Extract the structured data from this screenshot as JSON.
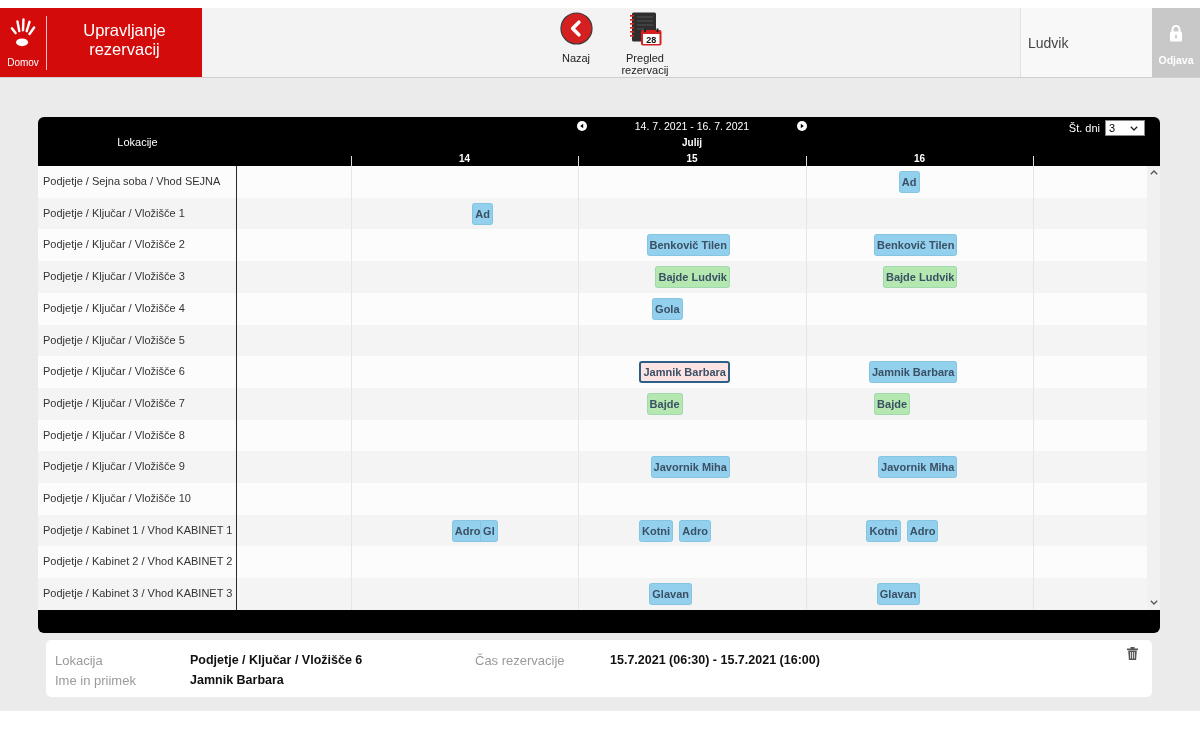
{
  "header": {
    "home": {
      "label": "Domov"
    },
    "title": "Upravljanje rezervacij",
    "toolbar": [
      {
        "kind": "back",
        "label": "Nazaj"
      },
      {
        "kind": "calendar",
        "label": "Pregled rezervacij",
        "icon_text": "28"
      }
    ],
    "user": "Ludvik",
    "logout": {
      "label": "Odjava"
    }
  },
  "scheduler": {
    "locations_heading": "Lokacije",
    "range": "14. 7. 2021 - 16. 7. 2021",
    "month": "Julij",
    "days": [
      "14",
      "15",
      "16"
    ],
    "days_count": {
      "label": "Št. dni",
      "value": "3"
    },
    "rows": [
      {
        "location": "Podjetje / Sejna soba / Vhod SEJNA",
        "events": [
          {
            "text": "Ad",
            "level": 0.75,
            "color": "#93d0ee",
            "selected": false
          }
        ]
      },
      {
        "location": "Podjetje / Ključar / Vložišče 1",
        "events": [
          {
            "text": "Ad",
            "level": 0.2813,
            "color": "#93d0ee",
            "selected": false
          }
        ]
      },
      {
        "location": "Podjetje / Ključar / Vložišče 2",
        "events": [
          {
            "text": "Benkovič Tilen",
            "level": 0.5417,
            "color": "#93d0ee",
            "selected": false
          },
          {
            "text": "Benkovič Tilen",
            "level": 0.7917,
            "color": "#93d0ee",
            "selected": false
          }
        ]
      },
      {
        "location": "Podjetje / Ključar / Vložišče 3",
        "events": [
          {
            "text": "Bajde Ludvik",
            "level": 0.5417,
            "color": "#b5e8b0",
            "selected": false
          },
          {
            "text": "Bajde Ludvik",
            "level": 0.7917,
            "color": "#b5e8b0",
            "selected": false
          }
        ]
      },
      {
        "location": "Podjetje / Ključar / Vložišče 4",
        "events": [
          {
            "text": "Gola",
            "level": 0.4896,
            "color": "#93d0ee",
            "selected": false
          }
        ]
      },
      {
        "location": "Podjetje / Ključar / Vložišče 5"
      },
      {
        "location": "Podjetje / Ključar / Vložišče 6",
        "events": [
          {
            "text": "Jamnik Barbara",
            "level": 0.5417,
            "selected": true
          },
          {
            "text": "Jamnik Barbara",
            "level": 0.7917,
            "color": "#93d0ee",
            "selected": false
          }
        ]
      },
      {
        "location": "Podjetje / Ključar / Vložišče 7",
        "events": [
          {
            "text": "Bajde",
            "level": 0.4896,
            "color": "#b5e8b0",
            "selected": false
          },
          {
            "text": "Bajde",
            "level": 0.7396,
            "color": "#b5e8b0",
            "selected": false
          }
        ]
      },
      {
        "location": "Podjetje / Ključar / Vložišče 8"
      },
      {
        "location": "Podjetje / Ključar / Vložišče 9",
        "events": [
          {
            "text": "Javornik Miha",
            "level": 0.5417,
            "color": "#93d0ee",
            "selected": false
          },
          {
            "text": "Javornik Miha",
            "level": 0.7917,
            "color": "#93d0ee",
            "selected": false
          }
        ]
      },
      {
        "location": "Podjetje / Ključar / Vložišče 10"
      },
      {
        "location": "Podjetje / Kabinet 1 / Vhod KABINET 1",
        "events": [
          {
            "text": "Adro",
            "level": 0.2708,
            "color": "#93d0ee",
            "selected": false
          },
          {
            "text": "Gl",
            "level": 0.2865,
            "color": "#93d0ee",
            "selected": false
          },
          {
            "text": "Kotni",
            "level": 0.4792,
            "color": "#93d0ee",
            "selected": false
          },
          {
            "text": "Adro",
            "level": 0.5208,
            "color": "#93d0ee",
            "selected": false
          },
          {
            "text": "Kotni",
            "level": 0.7292,
            "color": "#93d0ee",
            "selected": false
          },
          {
            "text": "Adro",
            "level": 0.7708,
            "color": "#93d0ee",
            "selected": false
          }
        ]
      },
      {
        "location": "Podjetje / Kabinet 2 / Vhod KABINET 2"
      },
      {
        "location": "Podjetje / Kabinet 3 / Vhod KABINET 3",
        "events": [
          {
            "text": "Glavan",
            "level": 0.5,
            "color": "#93d0ee",
            "selected": false
          },
          {
            "text": "Glavan",
            "level": 0.75,
            "color": "#93d0ee",
            "selected": false
          }
        ]
      }
    ]
  },
  "details": {
    "fields": [
      {
        "label": "Lokacija",
        "value": "Podjetje / Ključar / Vložišče 6"
      },
      {
        "label": "Čas rezervacije",
        "value": "15.7.2021 (06:30) - 15.7.2021 (16:00)"
      },
      {
        "label": "Ime in priimek",
        "value": "Jamnik Barbara"
      }
    ]
  }
}
